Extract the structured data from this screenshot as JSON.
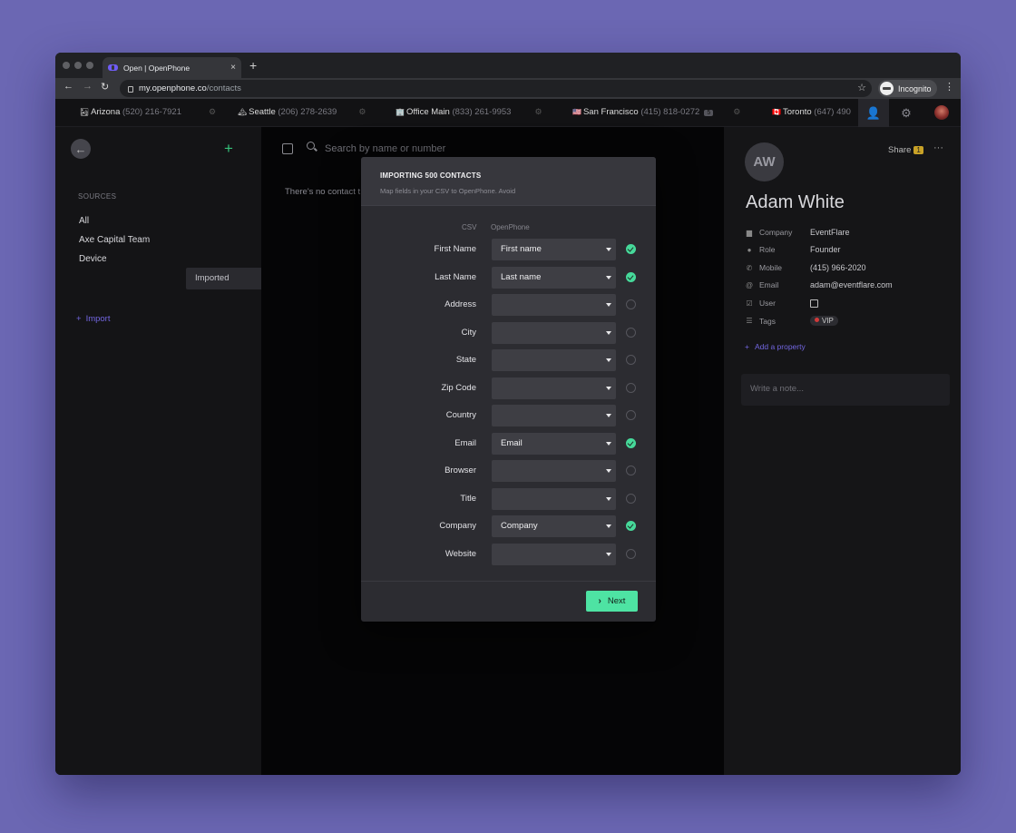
{
  "browser": {
    "tab_title": "Open | OpenPhone",
    "tab_close": "×",
    "new_tab": "+",
    "url_host": "my.openphone.co",
    "url_path": "/contacts",
    "incognito_label": "Incognito"
  },
  "phone_bar": {
    "items": [
      {
        "flag": "🏜",
        "name": "Arizona",
        "number": "(520) 216-7921"
      },
      {
        "flag": "🏔",
        "name": "Seattle",
        "number": "(206) 278-2639"
      },
      {
        "flag": "🏢",
        "name": "Office Main",
        "number": "(833) 261-9953"
      },
      {
        "flag": "🇺🇸",
        "name": "San Francisco",
        "number": "(415) 818-0272",
        "badge": "5"
      },
      {
        "flag": "🇨🇦",
        "name": "Toronto",
        "number": "(647) 490"
      }
    ]
  },
  "sidebar": {
    "sources_label": "SOURCES",
    "items": [
      "All",
      "Axe Capital Team",
      "Device",
      "Imported"
    ],
    "selected": "Imported",
    "import_label": "Import"
  },
  "center": {
    "search_placeholder": "Search by name or number",
    "empty_text": "There's no contact t"
  },
  "contact": {
    "initials": "AW",
    "name": "Adam White",
    "share_label": "Share",
    "share_count": "1",
    "properties": {
      "company": {
        "label": "Company",
        "value": "EventFlare"
      },
      "role": {
        "label": "Role",
        "value": "Founder"
      },
      "mobile": {
        "label": "Mobile",
        "value": "(415) 966-2020"
      },
      "email": {
        "label": "Email",
        "value": "adam@eventflare.com"
      },
      "user": {
        "label": "User"
      },
      "tags": {
        "label": "Tags",
        "value": "VIP"
      }
    },
    "add_property_label": "Add a property",
    "note_placeholder": "Write a note..."
  },
  "modal": {
    "title": "IMPORTING 500 CONTACTS",
    "subtitle": "Map fields in your CSV to OpenPhone. Avoid",
    "col_csv": "CSV",
    "col_openphone": "OpenPhone",
    "rows": [
      {
        "csv": "First Name",
        "mapped": "First name",
        "ok": true
      },
      {
        "csv": "Last Name",
        "mapped": "Last name",
        "ok": true
      },
      {
        "csv": "Address",
        "mapped": "",
        "ok": false
      },
      {
        "csv": "City",
        "mapped": "",
        "ok": false
      },
      {
        "csv": "State",
        "mapped": "",
        "ok": false
      },
      {
        "csv": "Zip Code",
        "mapped": "",
        "ok": false
      },
      {
        "csv": "Country",
        "mapped": "",
        "ok": false
      },
      {
        "csv": "Email",
        "mapped": "Email",
        "ok": true
      },
      {
        "csv": "Browser",
        "mapped": "",
        "ok": false
      },
      {
        "csv": "Title",
        "mapped": "",
        "ok": false
      },
      {
        "csv": "Company",
        "mapped": "Company",
        "ok": true
      },
      {
        "csv": "Website",
        "mapped": "",
        "ok": false
      }
    ],
    "next_label": "Next"
  },
  "colors": {
    "background": "#6b67b3",
    "accent_green": "#4ee3a3",
    "accent_purple": "#7266e0",
    "share_badge": "#c9a227"
  }
}
